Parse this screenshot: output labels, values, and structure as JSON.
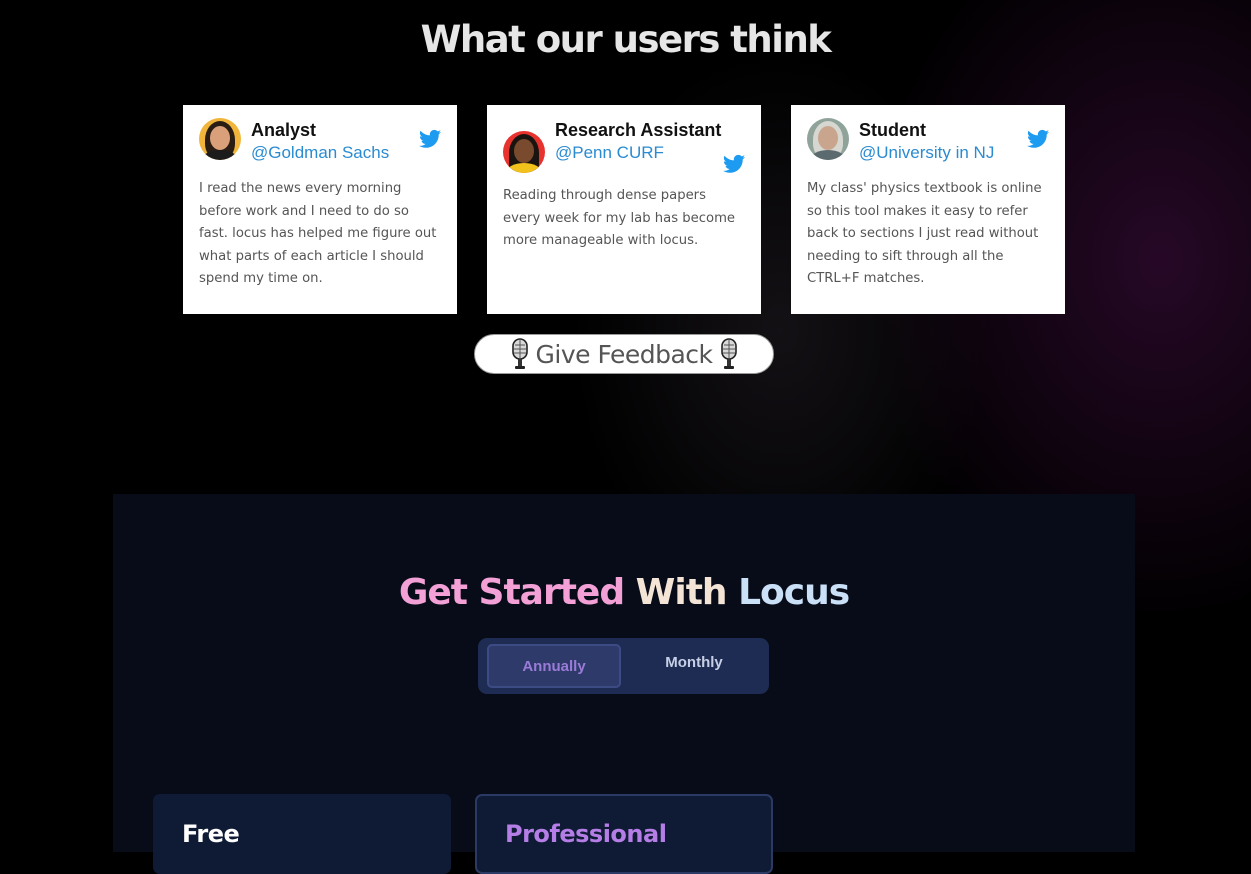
{
  "testimonials": {
    "title": "What our users think",
    "cards": [
      {
        "role": "Analyst",
        "handle": "@Goldman Sachs",
        "quote": "I read the news every morning before work and I need to do so fast. locus has helped me figure out what parts of each article I should spend my time on."
      },
      {
        "role": "Research Assistant",
        "handle": "@Penn CURF",
        "quote": "Reading through dense papers every week for my lab has become more manageable with locus."
      },
      {
        "role": "Student",
        "handle": "@University in NJ",
        "quote": "My class' physics textbook is online so this tool makes it easy to refer back to sections I just read without needing to sift through all the CTRL+F matches."
      }
    ],
    "feedback_button": {
      "label": "Give Feedback",
      "icon": "microphone-icon"
    },
    "icons": {
      "social": "twitter-icon",
      "twitter_color": "#1d9bf0"
    }
  },
  "pricing": {
    "title_part1": "Get Started",
    "title_part2": "With",
    "title_part3": "Locus",
    "billing_toggle": {
      "options": [
        "Annually",
        "Monthly"
      ],
      "selected": "Annually"
    },
    "plans": [
      {
        "name": "Free"
      },
      {
        "name": "Professional"
      }
    ],
    "colors": {
      "accent_purple": "#b57ee6",
      "title_pink": "#f2a0d6",
      "toggle_bg": "#1e2c53"
    }
  }
}
